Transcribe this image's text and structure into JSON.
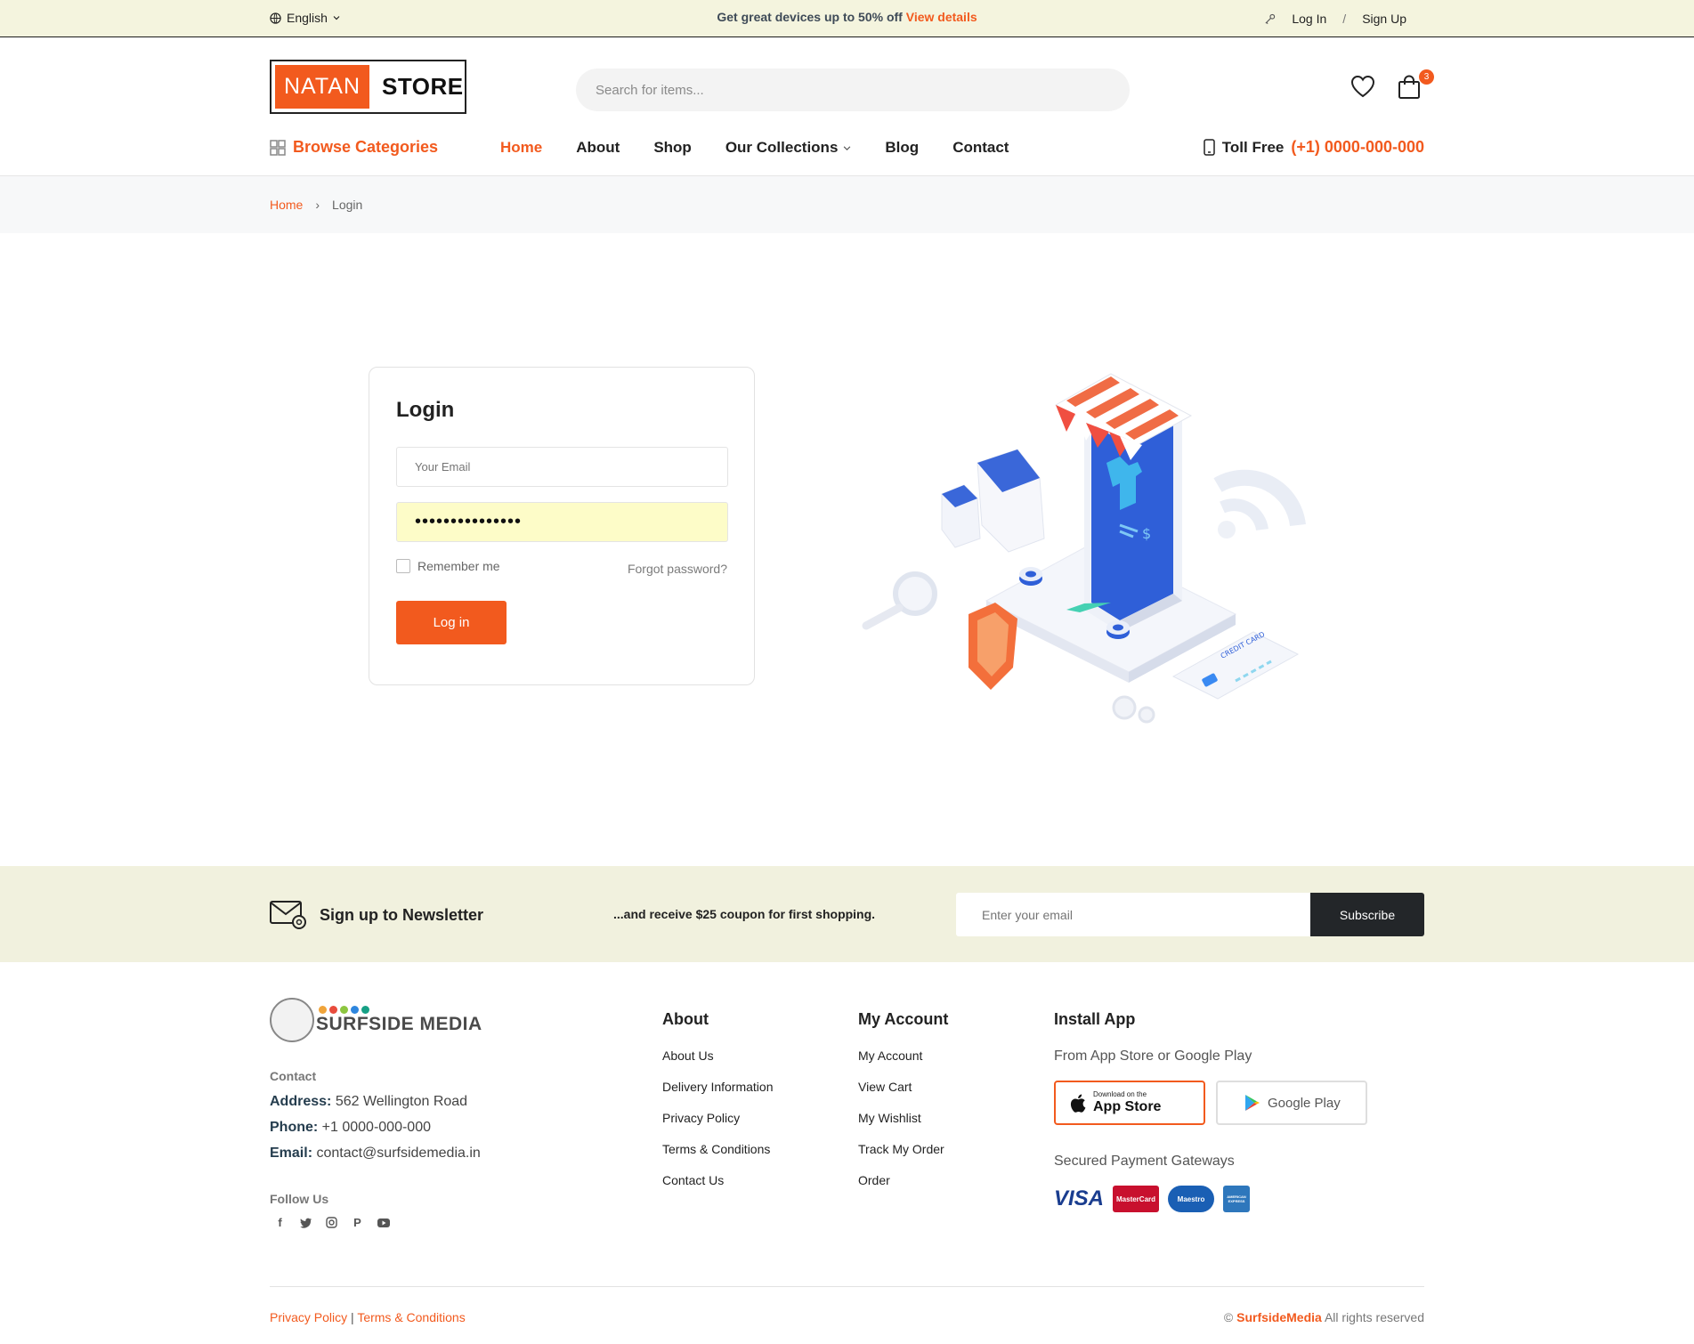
{
  "topbar": {
    "language": "English",
    "promo_text": "Get great devices up to 50% off",
    "promo_link": "View details",
    "login": "Log In",
    "separator": "/",
    "signup": "Sign Up"
  },
  "header": {
    "logo_part1": "NATAN",
    "logo_part2": "STORE",
    "search_placeholder": "Search for items...",
    "cart_count": "3",
    "browse_categories": "Browse Categories",
    "nav": [
      "Home",
      "About",
      "Shop",
      "Our Collections",
      "Blog",
      "Contact"
    ],
    "toll_free_label": "Toll Free",
    "toll_free_number": "(+1) 0000-000-000"
  },
  "breadcrumb": {
    "home": "Home",
    "separator": "›",
    "current": "Login"
  },
  "login": {
    "title": "Login",
    "email_placeholder": "Your Email",
    "password_value": "•••••••••••••••",
    "remember_me": "Remember me",
    "forgot_password": "Forgot password?",
    "submit": "Log in"
  },
  "illustration": {
    "credit_card_text": "CREDIT CARD"
  },
  "newsletter": {
    "title": "Sign up to Newsletter",
    "subtitle": "...and receive $25 coupon for first shopping.",
    "placeholder": "Enter your email",
    "button": "Subscribe"
  },
  "footer": {
    "brand": "SURFSIDE MEDIA",
    "contact_title": "Contact",
    "address_label": "Address:",
    "address": "562 Wellington Road",
    "phone_label": "Phone:",
    "phone": "+1 0000-000-000",
    "email_label": "Email:",
    "email": "contact@surfsidemedia.in",
    "follow_title": "Follow Us",
    "about_title": "About",
    "about_links": [
      "About Us",
      "Delivery Information",
      "Privacy Policy",
      "Terms & Conditions",
      "Contact Us"
    ],
    "account_title": "My Account",
    "account_links": [
      "My Account",
      "View Cart",
      "My Wishlist",
      "Track My Order",
      "Order"
    ],
    "app_title": "Install App",
    "app_sub": "From App Store or Google Play",
    "appstore_small": "Download on the",
    "appstore_big": "App Store",
    "googleplay": "Google Play",
    "payment_title": "Secured Payment Gateways",
    "payments": [
      "VISA",
      "MasterCard",
      "Maestro",
      "AMERICAN EXPRESS"
    ],
    "bottom_privacy": "Privacy Policy",
    "bottom_bar": "|",
    "bottom_terms": "Terms & Conditions",
    "copyright_symbol": "©",
    "copyright_brand": "SurfsideMedia",
    "copyright_text": "All rights reserved"
  },
  "colors": {
    "accent": "#f25a1e",
    "topbar_bg": "#f4f4de",
    "newsletter_bg": "#f1f1de",
    "dark_button": "#232629"
  }
}
